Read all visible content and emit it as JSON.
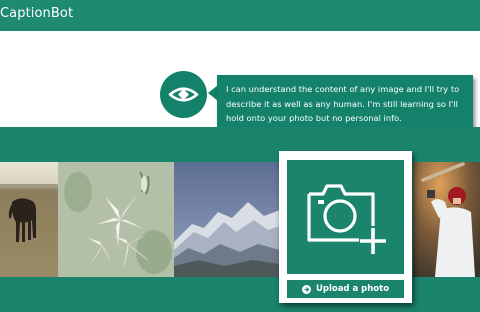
{
  "header": {
    "title": "CaptionBot"
  },
  "intro": {
    "message": "I can understand the content of any image and I'll try to describe it as well as any human. I'm still learning so I'll hold onto your photo but no personal info."
  },
  "upload": {
    "label": "Upload a photo"
  },
  "colors": {
    "brand": "#1e8a72",
    "bubble": "#14826b"
  },
  "photos": [
    {
      "name": "horse-in-field"
    },
    {
      "name": "white-lilies"
    },
    {
      "name": "snowy-mountains"
    },
    {
      "name": "baseball-batter"
    }
  ]
}
